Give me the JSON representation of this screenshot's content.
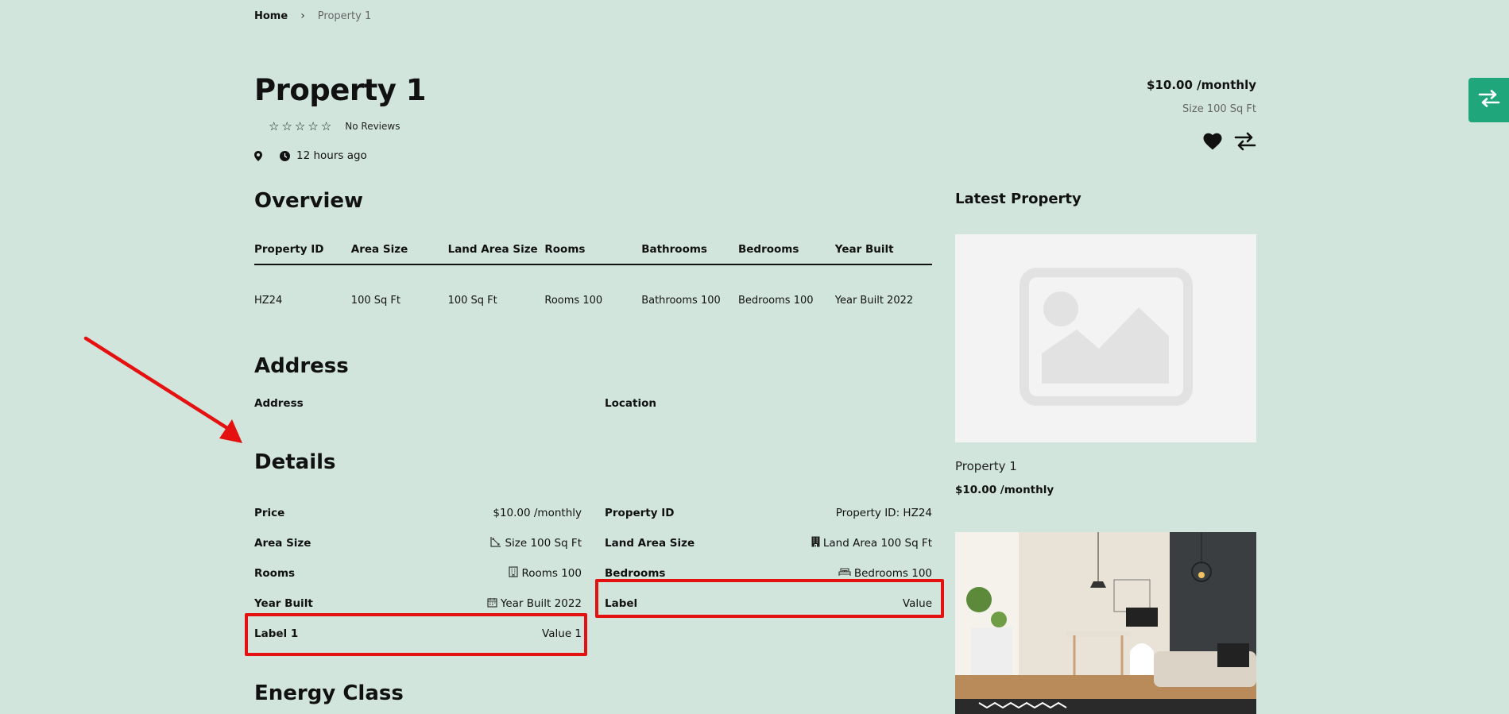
{
  "breadcrumb": {
    "home": "Home",
    "current": "Property 1"
  },
  "property": {
    "title": "Property 1",
    "reviews": "No Reviews",
    "time": "12 hours ago",
    "price": "$10.00 /monthly",
    "size": "Size 100 Sq Ft",
    "rating": 0
  },
  "overview": {
    "heading": "Overview",
    "headers": [
      "Property ID",
      "Area Size",
      "Land Area Size",
      "Rooms",
      "Bathrooms",
      "Bedrooms",
      "Year Built"
    ],
    "values": [
      "HZ24",
      "100 Sq Ft",
      "100 Sq Ft",
      "Rooms 100",
      "Bathrooms 100",
      "Bedrooms 100",
      "Year Built 2022"
    ]
  },
  "address": {
    "heading": "Address",
    "address_label": "Address",
    "location_label": "Location"
  },
  "details": {
    "heading": "Details",
    "left": [
      {
        "label": "Price",
        "value": "$10.00 /monthly",
        "icon": ""
      },
      {
        "label": "Area Size",
        "value": "Size 100 Sq Ft",
        "icon": "area-icon"
      },
      {
        "label": "Rooms",
        "value": "Rooms 100",
        "icon": "building-icon"
      },
      {
        "label": "Year Built",
        "value": "Year Built 2022",
        "icon": "calendar-icon"
      },
      {
        "label": "Label 1",
        "value": "Value 1",
        "icon": ""
      }
    ],
    "right": [
      {
        "label": "Property ID",
        "value": "Property ID: HZ24",
        "icon": ""
      },
      {
        "label": "Land Area Size",
        "value": "Land Area 100 Sq Ft",
        "icon": "office-building-icon"
      },
      {
        "label": "Bedrooms",
        "value": "Bedrooms 100",
        "icon": "bed-icon"
      },
      {
        "label": "Label",
        "value": "Value",
        "icon": ""
      }
    ]
  },
  "energy": {
    "heading": "Energy Class"
  },
  "sidebar": {
    "heading": "Latest Property",
    "items": [
      {
        "title": "Property 1",
        "price": "$10.00 /monthly"
      }
    ]
  },
  "colors": {
    "background": "#d1e5dd",
    "accent": "#1fa67a",
    "highlight": "#e51010"
  }
}
